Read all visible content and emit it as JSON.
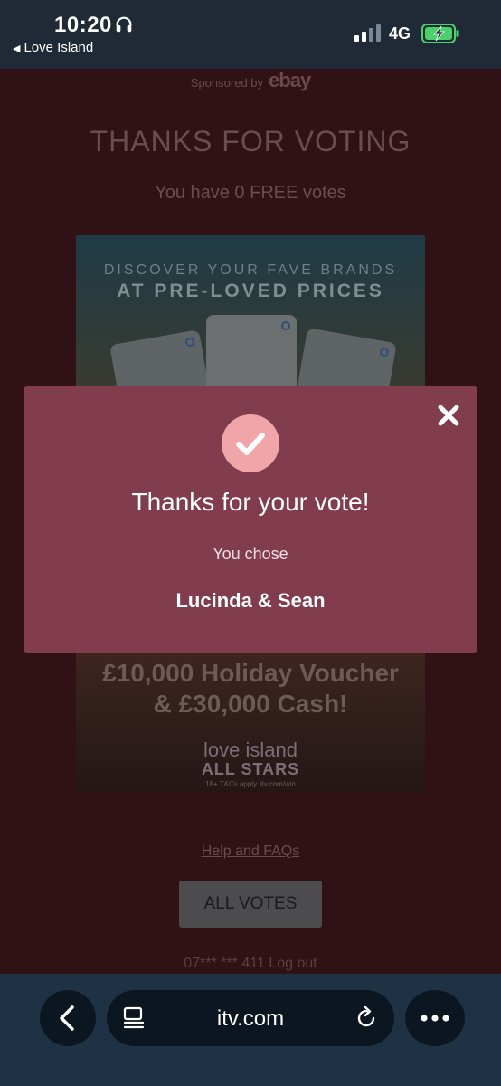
{
  "status_bar": {
    "time": "10:20",
    "back_app": "Love Island",
    "network": "4G",
    "icons": [
      "headphones-icon",
      "signal-icon",
      "battery-charging-icon"
    ]
  },
  "page": {
    "sponsor_prefix": "Sponsored by",
    "sponsor_brand": "ebay",
    "heading": "THANKS FOR VOTING",
    "free_votes": "You have 0 FREE votes",
    "ad": {
      "line1": "DISCOVER YOUR FAVE BRANDS",
      "line2": "AT PRE-LOVED PRICES",
      "prize_line1": "£10,000 Holiday Voucher",
      "prize_line2": "& £30,000 Cash!",
      "logo_line1": "love island",
      "logo_line2": "ALL STARS",
      "terms": "18+ T&Cs apply. itv.com/win"
    },
    "help_link": "Help and FAQs",
    "all_votes_button": "ALL VOTES",
    "account": "07*** *** 411 Log out"
  },
  "modal": {
    "title": "Thanks for your vote!",
    "subtitle": "You chose",
    "choice": "Lucinda & Sean",
    "colors": {
      "background": "#813d4e",
      "check_circle": "#f0a5a9"
    }
  },
  "browser": {
    "url": "itv.com",
    "icons": [
      "back-chevron-icon",
      "tabs-icon",
      "reload-icon",
      "more-icon"
    ]
  }
}
